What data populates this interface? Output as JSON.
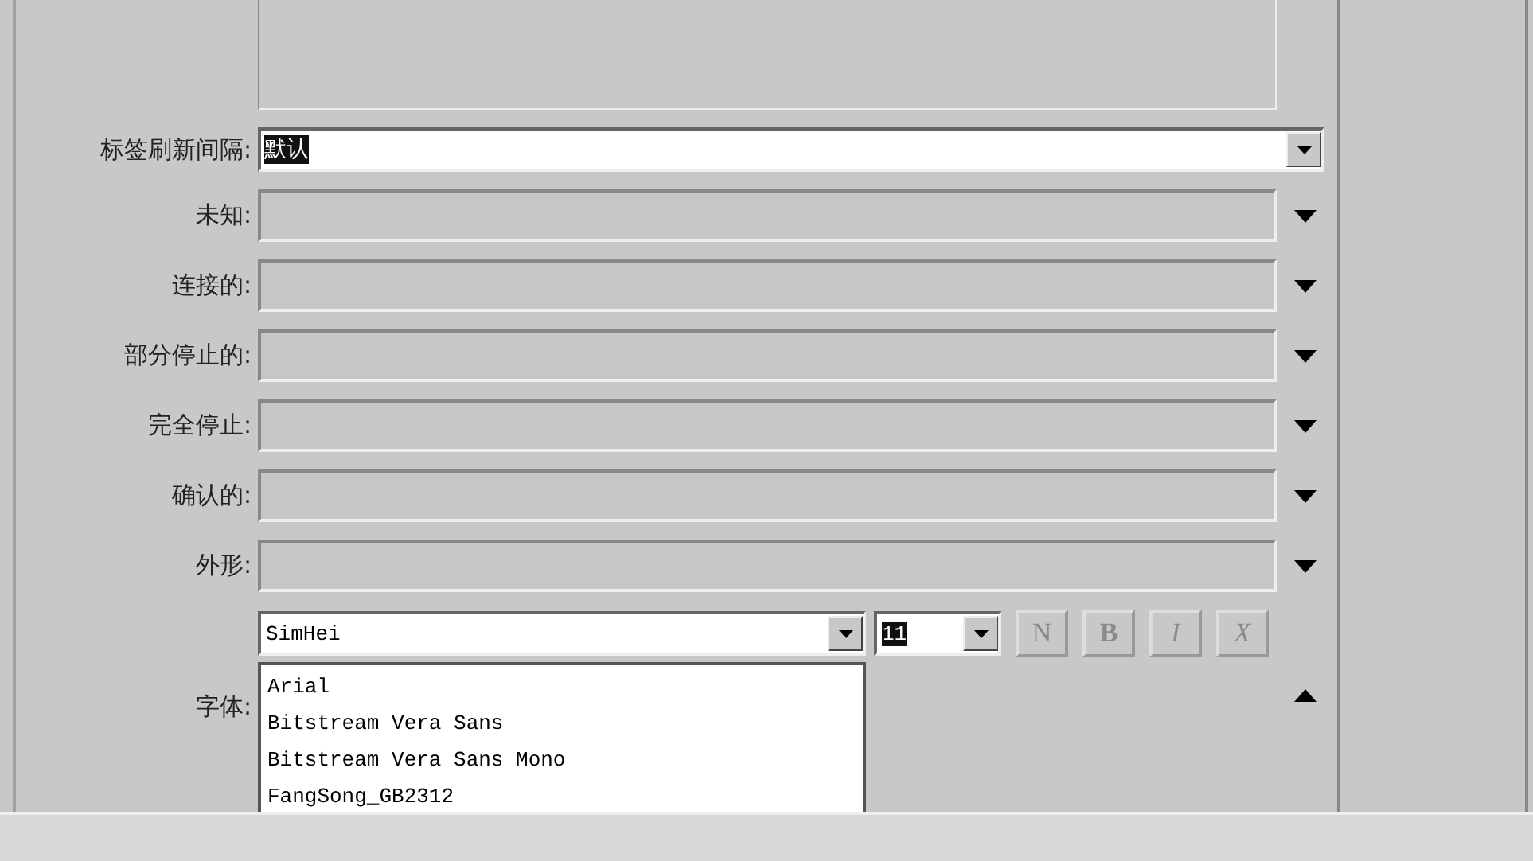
{
  "rows": [
    {
      "kind": "select",
      "label": "标签刷新间隔:",
      "value": "默认",
      "value_selected": true
    },
    {
      "kind": "swatch",
      "label": "未知:"
    },
    {
      "kind": "swatch",
      "label": "连接的:"
    },
    {
      "kind": "swatch",
      "label": "部分停止的:"
    },
    {
      "kind": "swatch",
      "label": "完全停止:"
    },
    {
      "kind": "swatch",
      "label": "确认的:"
    },
    {
      "kind": "swatch",
      "label": "外形:"
    }
  ],
  "font": {
    "label": "字体:",
    "family": "SimHei",
    "size": "11",
    "size_selected": true,
    "expanded": true,
    "styles": [
      {
        "label": "N",
        "disabled": true
      },
      {
        "label": "B",
        "disabled": true
      },
      {
        "label": "I",
        "disabled": true
      },
      {
        "label": "X",
        "disabled": true
      }
    ],
    "options": [
      "Arial",
      "Bitstream Vera Sans",
      "Bitstream Vera Sans Mono",
      "FangSong_GB2312"
    ]
  }
}
